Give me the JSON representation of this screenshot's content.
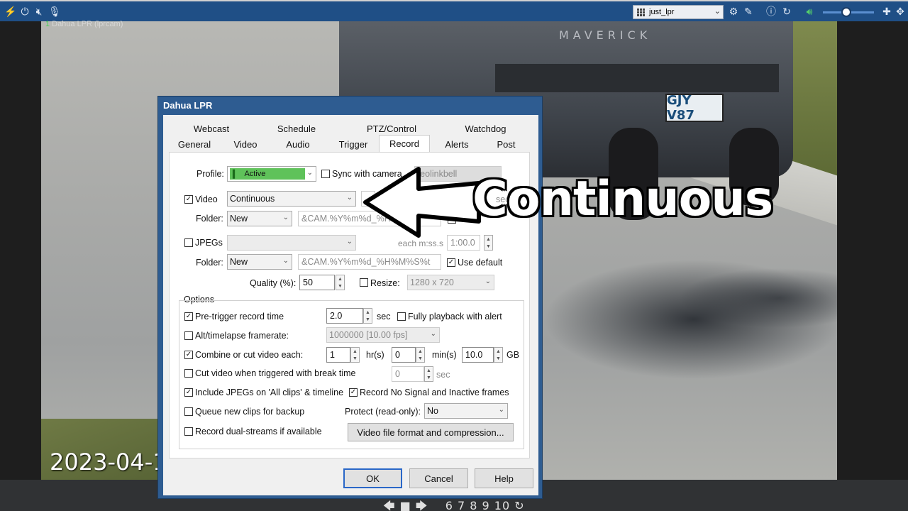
{
  "topbar": {
    "camera_select": "just_lpr"
  },
  "video": {
    "camera_title_num": "1",
    "camera_title": "Dahua LPR (lprcam)",
    "timestamp": "2023-04-1",
    "truck_brand": "MAVERICK",
    "plate": "GJY V87"
  },
  "bottom": {
    "nav": "6 7 8 9 10"
  },
  "overlay": {
    "label": "Continuous"
  },
  "dialog": {
    "title": "Dahua LPR",
    "tabs_row1": [
      "Webcast",
      "Schedule",
      "PTZ/Control",
      "Watchdog"
    ],
    "tabs_row2": [
      "General",
      "Video",
      "Audio",
      "Trigger",
      "Record",
      "Alerts",
      "Post"
    ],
    "active_tab": "Record",
    "profile": {
      "label": "Profile:",
      "value": "Active",
      "sync_label": "Sync with camera",
      "sync_value": "reolinkbell"
    },
    "video": {
      "label": "Video",
      "mode": "Continuous",
      "sec_suffix": "sec",
      "folder_label": "Folder:",
      "folder": "New",
      "pattern": "&CAM.%Y%m%d_%H",
      "use_default_partial": "se de"
    },
    "jpegs": {
      "label": "JPEGs",
      "each_label": "each m:ss.s",
      "each_value": "1:00.0",
      "folder_label": "Folder:",
      "folder": "New",
      "pattern": "&CAM.%Y%m%d_%H%M%S%t",
      "use_default": "Use default"
    },
    "quality": {
      "label": "Quality (%):",
      "value": "50",
      "resize_label": "Resize:",
      "resize_value": "1280 x 720"
    },
    "options": {
      "title": "Options",
      "pretrigger_label": "Pre-trigger record time",
      "pretrigger_value": "2.0",
      "pretrigger_unit": "sec",
      "fully_playback": "Fully playback with alert",
      "alt_framerate_label": "Alt/timelapse framerate:",
      "alt_framerate_value": "1000000 [10.00 fps]",
      "combine_label": "Combine or cut video each:",
      "combine_hr": "1",
      "hr_unit": "hr(s)",
      "combine_min": "0",
      "min_unit": "min(s)",
      "combine_gb": "10.0",
      "gb_unit": "GB",
      "cut_label": "Cut video when triggered with break time",
      "cut_value": "0",
      "cut_unit": "sec",
      "include_jpegs": "Include JPEGs on 'All clips' & timeline",
      "record_no_signal": "Record No Signal and Inactive frames",
      "queue_backup": "Queue new clips for backup",
      "protect_label": "Protect (read-only):",
      "protect_value": "No",
      "dual_streams": "Record dual-streams if available",
      "format_button": "Video file format and compression..."
    },
    "buttons": {
      "ok": "OK",
      "cancel": "Cancel",
      "help": "Help"
    }
  },
  "colors": {
    "title_bar": "#2e5c91",
    "profile_active": "#5fc25a",
    "topbar": "#1f4f86"
  }
}
